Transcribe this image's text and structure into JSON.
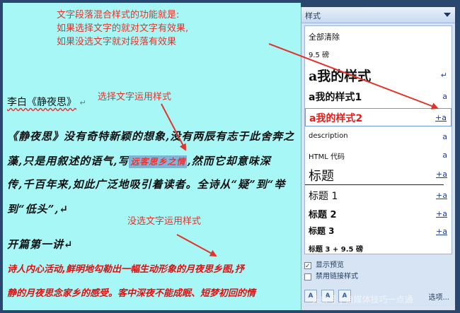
{
  "annotations": {
    "top": "文字段落混合样式的功能就是:\n如果选择文字的就对文字有效果,\n如果没选文字就对段落有效果",
    "selected": "选择文字运用样式",
    "unselected": "没选文字运用样式"
  },
  "doc": {
    "heading": "李白《静夜思》",
    "mark": "↵",
    "l1": "《静夜思》没有奇特新颖的想象,没有两辰有志于此舍奔之",
    "l2a": "藻,只是用叙述的语气,写",
    "l2hl": "远客思乡之情",
    "l2b": ",然而它却意味深",
    "l3": "传,千百年来,如此广泛地吸引着读者。全诗从“疑”到“举",
    "l4": "到“低头”,↵",
    "l5": "开篇第一讲↵",
    "r1": "诗人内心活动,鲜明地勾勒出一幅生动形象的月夜思乡图,抒",
    "r2": "静的月夜思念家乡的感受。客中深夜不能成眠、短梦初回的情"
  },
  "pane": {
    "title": "样式",
    "items": [
      {
        "label": "全部清除",
        "mark": ""
      },
      {
        "label": "9.5 磅",
        "mark": ""
      },
      {
        "label": "a我的样式",
        "mark": "↵"
      },
      {
        "label": "a我的样式1",
        "mark": "a"
      },
      {
        "label": "a我的样式2",
        "mark": "+a"
      },
      {
        "label": "description",
        "mark": "a"
      },
      {
        "label": "HTML 代码",
        "mark": "a"
      },
      {
        "label": "标题",
        "mark": "+a"
      },
      {
        "label": "标题 1",
        "mark": "+a"
      },
      {
        "label": "标题 2",
        "mark": "+a"
      },
      {
        "label": "标题 3",
        "mark": "+a"
      },
      {
        "label": "标题 3 + 9.5 磅",
        "mark": ""
      }
    ],
    "show_preview": "显示预览",
    "disable_linked": "禁用链接样式",
    "btn_new": "A",
    "btn_inspect": "A",
    "btn_manage": "A",
    "options": "选项..."
  },
  "watermark": "头条号 | 自媒体技巧一点通"
}
